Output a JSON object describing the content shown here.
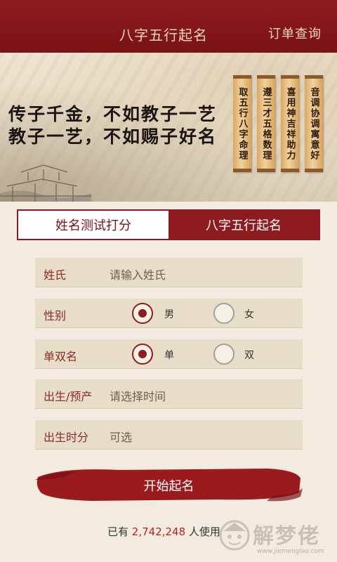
{
  "header": {
    "title": "八字五行起名",
    "order_link": "订单查询"
  },
  "banner": {
    "line1": "传子千金，不如教子一艺",
    "line2": "教子一艺，不如赐子好名",
    "scrolls": [
      "取五行八字命理",
      "遵三才五格数理",
      "喜用神吉祥助力",
      "音调协调寓意好"
    ]
  },
  "tabs": {
    "name_test": "姓名测试打分",
    "bazi_name": "八字五行起名"
  },
  "form": {
    "surname_label": "姓氏",
    "surname_placeholder": "请输入姓氏",
    "gender_label": "性别",
    "gender_male": "男",
    "gender_female": "女",
    "name_type_label": "单双名",
    "name_single": "单",
    "name_double": "双",
    "birth_label": "出生/预产",
    "birth_placeholder": "请选择时间",
    "birth_time_label": "出生时分",
    "birth_time_placeholder": "可选"
  },
  "start_button": "开始起名",
  "usage": {
    "prefix": "已有",
    "count": "2,742,248",
    "suffix": "人使用"
  },
  "watermark": {
    "brand": "解梦佬",
    "site": "www.jiemenglao.com"
  }
}
